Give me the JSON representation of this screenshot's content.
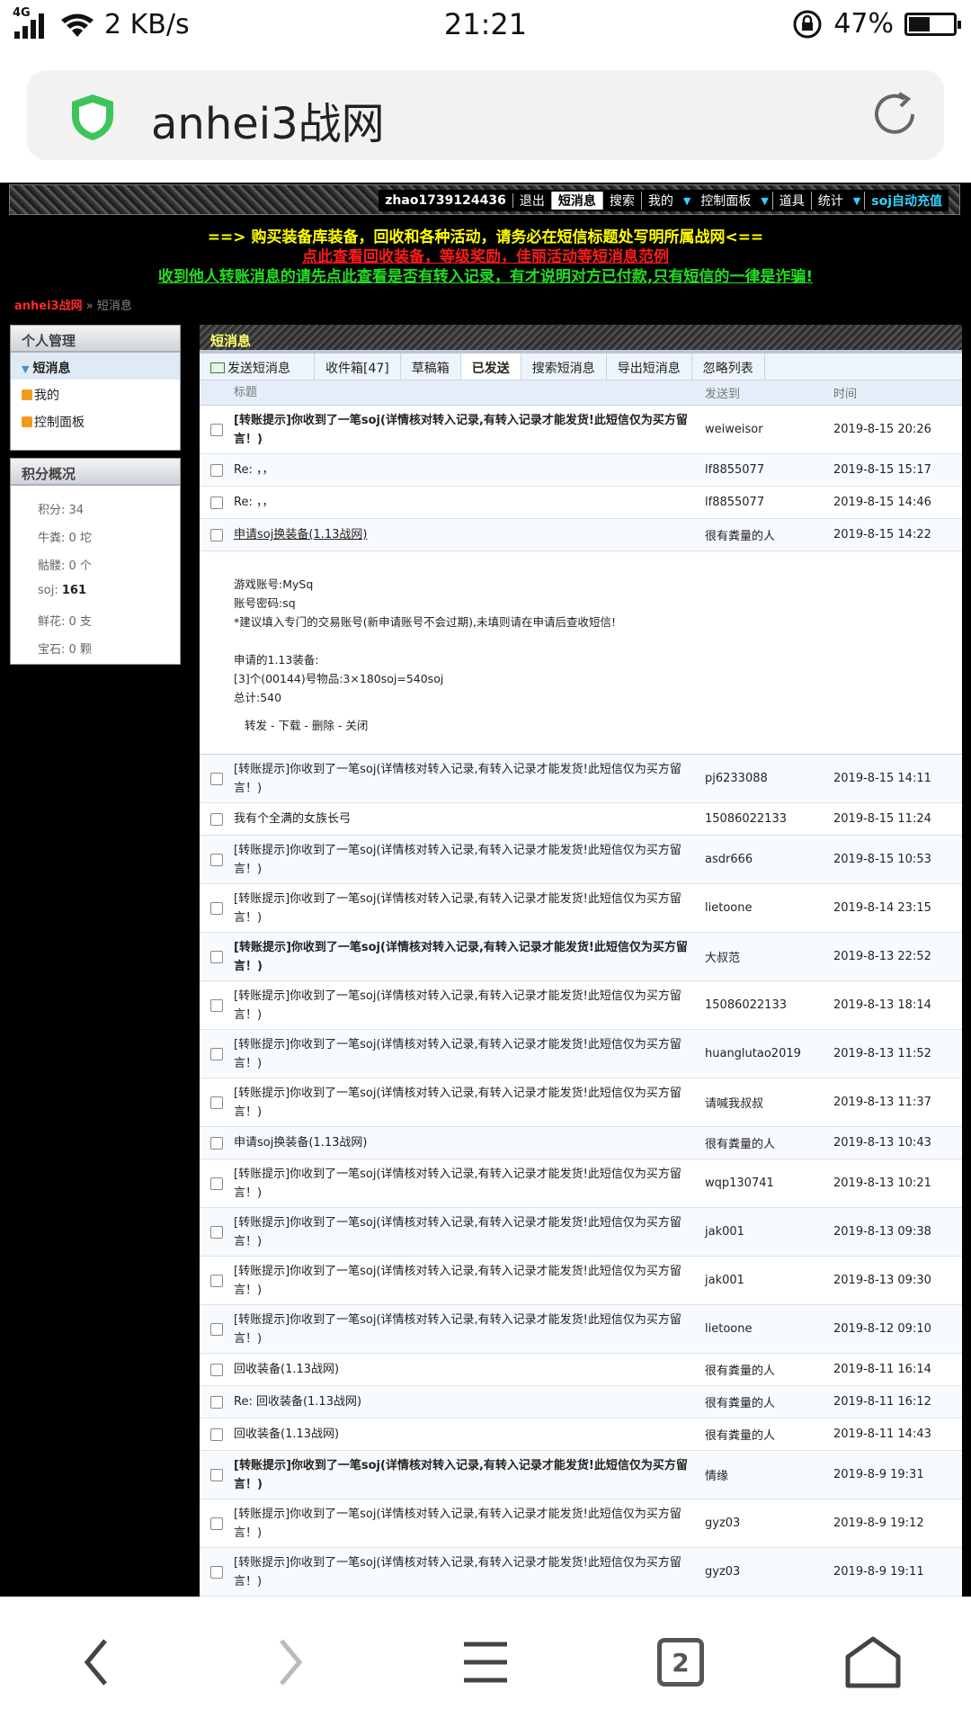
{
  "status": {
    "network": "4G",
    "speed": "2 KB/s",
    "time": "21:21",
    "battery": "47%",
    "battery_level": 0.47
  },
  "browser": {
    "url": "anhei3战网",
    "tab_count": "2"
  },
  "topnav": {
    "username": "zhao1739124436",
    "items": [
      "退出",
      "短消息",
      "搜索",
      "我的",
      "控制面板",
      "道具",
      "统计"
    ],
    "soj_link": "soj自动充值"
  },
  "notices": [
    "==> 购买装备库装备，回收和各种活动，请务必在短信标题处写明所属战网<==",
    "点此查看回收装备，等级奖励，佳丽活动等短消息范例",
    "收到他人转账消息的请先点此查看是否有转入记录，有才说明对方已付款,只有短信的一律是诈骗!"
  ],
  "breadcrumb": {
    "home": "anhei3战网",
    "separator": "»",
    "current": "短消息"
  },
  "sidebar": {
    "manage_title": "个人管理",
    "manage_items": [
      "短消息",
      "我的",
      "控制面板"
    ],
    "points_title": "积分概况",
    "points": [
      {
        "label": "积分: 34"
      },
      {
        "label": "牛粪: 0 坨"
      },
      {
        "label": "骷髅: 0 个"
      },
      {
        "label": "soj: ",
        "value": "161"
      },
      {
        "label": "鲜花: 0 支"
      },
      {
        "label": "宝石: 0 颗"
      }
    ]
  },
  "main": {
    "title": "短消息",
    "tabs": [
      "发送短消息",
      "收件箱[47]",
      "草稿箱",
      "已发送",
      "搜索短消息",
      "导出短消息",
      "忽略列表"
    ],
    "columns": [
      "标题",
      "发送到",
      "时间"
    ],
    "rows": [
      {
        "title": "[转账提示]你收到了一笔soj(详情核对转入记录,有转入记录才能发货!此短信仅为买方留言！)",
        "to": "weiweisor",
        "time": "2019-8-15 20:26"
      },
      {
        "title": "Re: ，，",
        "to": "lf8855077",
        "time": "2019-8-15 15:17"
      },
      {
        "title": "Re: ，，",
        "to": "lf8855077",
        "time": "2019-8-15 14:46"
      },
      {
        "title": "申请soj换装备(1.13战网)",
        "to": "很有粪量的人",
        "time": "2019-8-15 14:22"
      },
      {
        "title": "[转账提示]你收到了一笔soj(详情核对转入记录,有转入记录才能发货!此短信仅为买方留言！)",
        "to": "pj6233088",
        "time": "2019-8-15 14:11"
      },
      {
        "title": "我有个全满的女族长弓",
        "to": "15086022133",
        "time": "2019-8-15 11:24"
      },
      {
        "title": "[转账提示]你收到了一笔soj(详情核对转入记录,有转入记录才能发货!此短信仅为买方留言！)",
        "to": "asdr666",
        "time": "2019-8-15 10:53"
      },
      {
        "title": "[转账提示]你收到了一笔soj(详情核对转入记录,有转入记录才能发货!此短信仅为买方留言！)",
        "to": "lietoone",
        "time": "2019-8-14 23:15"
      },
      {
        "title": "[转账提示]你收到了一笔soj(详情核对转入记录,有转入记录才能发货!此短信仅为买方留言！)",
        "to": "大叔范",
        "time": "2019-8-13 22:52"
      },
      {
        "title": "[转账提示]你收到了一笔soj(详情核对转入记录,有转入记录才能发货!此短信仅为买方留言！)",
        "to": "15086022133",
        "time": "2019-8-13 18:14"
      },
      {
        "title": "[转账提示]你收到了一笔soj(详情核对转入记录,有转入记录才能发货!此短信仅为买方留言！)",
        "to": "huanglutao2019",
        "time": "2019-8-13 11:52"
      },
      {
        "title": "[转账提示]你收到了一笔soj(详情核对转入记录,有转入记录才能发货!此短信仅为买方留言！)",
        "to": "请喊我叔叔",
        "time": "2019-8-13 11:37"
      },
      {
        "title": "申请soj换装备(1.13战网)",
        "to": "很有粪量的人",
        "time": "2019-8-13 10:43"
      },
      {
        "title": "[转账提示]你收到了一笔soj(详情核对转入记录,有转入记录才能发货!此短信仅为买方留言！)",
        "to": "wqp130741",
        "time": "2019-8-13 10:21"
      },
      {
        "title": "[转账提示]你收到了一笔soj(详情核对转入记录,有转入记录才能发货!此短信仅为买方留言！)",
        "to": "jak001",
        "time": "2019-8-13 09:38"
      },
      {
        "title": "[转账提示]你收到了一笔soj(详情核对转入记录,有转入记录才能发货!此短信仅为买方留言！)",
        "to": "jak001",
        "time": "2019-8-13 09:30"
      },
      {
        "title": "[转账提示]你收到了一笔soj(详情核对转入记录,有转入记录才能发货!此短信仅为买方留言！)",
        "to": "lietoone",
        "time": "2019-8-12 09:10"
      },
      {
        "title": "回收装备(1.13战网)",
        "to": "很有粪量的人",
        "time": "2019-8-11 16:14"
      },
      {
        "title": "Re: 回收装备(1.13战网)",
        "to": "很有粪量的人",
        "time": "2019-8-11 16:12"
      },
      {
        "title": "回收装备(1.13战网)",
        "to": "很有粪量的人",
        "time": "2019-8-11 14:43"
      },
      {
        "title": "[转账提示]你收到了一笔soj(详情核对转入记录,有转入记录才能发货!此短信仅为买方留言！)",
        "to": "情缘",
        "time": "2019-8-9 19:31"
      },
      {
        "title": "[转账提示]你收到了一笔soj(详情核对转入记录,有转入记录才能发货!此短信仅为买方留言！)",
        "to": "gyz03",
        "time": "2019-8-9 19:12"
      },
      {
        "title": "[转账提示]你收到了一笔soj(详情核对转入记录,有转入记录才能发货!此短信仅为买方留言！)",
        "to": "gyz03",
        "time": "2019-8-9 19:11"
      }
    ],
    "detail": {
      "lines_a": [
        "游戏账号:MySq",
        "账号密码:sq",
        "*建议填入专门的交易账号(新申请账号不会过期),未填则请在申请后查收短信!"
      ],
      "lines_b": [
        "申请的1.13装备:",
        "[3]个(00144)号物品:3×180soj=540soj",
        "总计:540"
      ],
      "actions": "转发 - 下载 - 删除 - 关闭"
    }
  }
}
